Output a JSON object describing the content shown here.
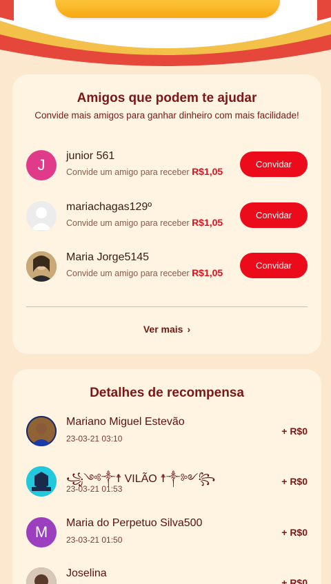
{
  "friends_card": {
    "title": "Amigos que podem te ajudar",
    "subtitle": "Convide mais amigos para ganhar dinheiro com mais facilidade!",
    "desc_prefix": "Convide um amigo para receber",
    "items": [
      {
        "name": "junior 561",
        "avatar_letter": "J",
        "avatar_color": "#e03a8a",
        "amount": "R$1,05",
        "button": "Convidar"
      },
      {
        "name": "mariachagas129º",
        "avatar_letter": "",
        "avatar_color": "#e9e9e9",
        "amount": "R$1,05",
        "button": "Convidar"
      },
      {
        "name": "Maria Jorge5145",
        "avatar_letter": "",
        "avatar_color": "#6b5a40",
        "amount": "R$1,05",
        "button": "Convidar"
      }
    ],
    "see_more": "Ver mais"
  },
  "rewards_card": {
    "title": "Detalhes de recompensa",
    "items": [
      {
        "name": "Mariano Miguel Estevão",
        "time": "23-03-21 03:10",
        "amount": "+ R$0",
        "avatar_letter": "",
        "avatar_color": "#2b3a8a"
      },
      {
        "name": "꧁༺༒☨ VILÃO ☨༒༻꧂",
        "time": "23-03-21 01:53",
        "amount": "+ R$0",
        "avatar_letter": "",
        "avatar_color": "#1ac3d8"
      },
      {
        "name": "Maria do Perpetuo Silva500",
        "time": "23-03-21 01:50",
        "amount": "+ R$0",
        "avatar_letter": "M",
        "avatar_color": "#9b3fbf"
      },
      {
        "name": "Joselina",
        "time": "",
        "amount": "+ R$0",
        "avatar_letter": "",
        "avatar_color": "#5a3a2a"
      }
    ]
  },
  "colors": {
    "accent": "#ec0b1b",
    "title": "#7a1717",
    "background": "#fbe8cf",
    "card": "#fff3e1"
  }
}
